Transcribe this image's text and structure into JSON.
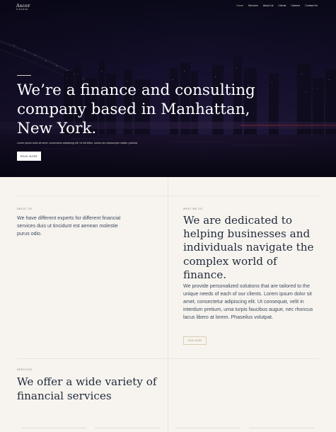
{
  "brand": {
    "name": "Ascer",
    "tagline": "FINANCE"
  },
  "nav": {
    "items": [
      {
        "label": "Home",
        "active": true
      },
      {
        "label": "Services",
        "active": false
      },
      {
        "label": "About Us",
        "active": false
      },
      {
        "label": "Clients",
        "active": false
      },
      {
        "label": "Careers",
        "active": false
      },
      {
        "label": "Contact Us",
        "active": false
      }
    ]
  },
  "hero": {
    "title": "We’re a finance and consulting company based in Manhattan, New York.",
    "description": "Lorem ipsum dolor sit amet, consectetur adipiscing elit. Ut elit tellus, luctus nec ullamcorper mattis, pulvinar.",
    "button_label": "READ MORE"
  },
  "about": {
    "eyebrow": "ABOUT US",
    "text": "We have different experts for different financial services duis ut tincidunt est aenean molestie purus odio."
  },
  "dedicated": {
    "eyebrow": "WHAT WE DO",
    "title": "We are dedicated to helping businesses and individuals navigate the complex world of finance.",
    "text": "We provide personalized solutions that are tailored to the unique needs of each of our clients. Lorem ipsum dolor sit amet, consectetur adipiscing elit. Ut consequat, velit in interdum pretium, urna turpis faucibus augue, nec rhoncus lacus libero at lorem. Phaseilus volutpat.",
    "button_label": "READ MORE"
  },
  "services": {
    "eyebrow": "SERVICES",
    "title": "We offer a wide variety of financial services"
  },
  "colors": {
    "background": "#f7f4ef",
    "heading": "#1f2a3a",
    "body_text": "#3c4a5e",
    "accent": "#c9b98f"
  }
}
